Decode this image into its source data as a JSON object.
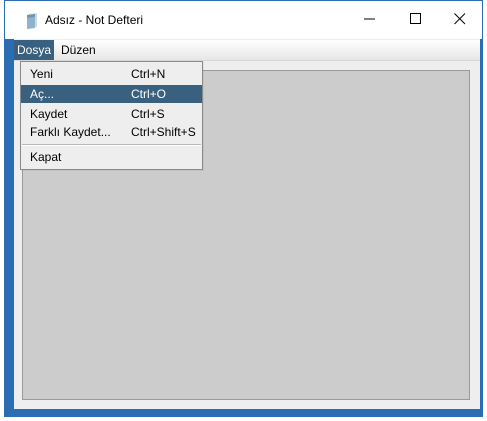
{
  "window": {
    "title": "Adsız - Not Defteri",
    "frame_color": "#2b6db3"
  },
  "menubar": {
    "menus": [
      {
        "label": "Dosya",
        "active": true
      },
      {
        "label": "Düzen",
        "active": false
      }
    ],
    "selection_color": "#39607e"
  },
  "file_menu": {
    "items": [
      {
        "label": "Yeni",
        "shortcut": "Ctrl+N"
      },
      {
        "label": "Aç...",
        "shortcut": "Ctrl+O",
        "selected": true
      },
      {
        "label": "Kaydet",
        "shortcut": "Ctrl+S"
      },
      {
        "label": "Farklı Kaydet...",
        "shortcut": "Ctrl+Shift+S"
      },
      {
        "label": "Kapat",
        "shortcut": ""
      }
    ]
  },
  "editor": {
    "background": "#cccccc"
  },
  "icons": {
    "app": "notepad-app-icon",
    "minimize": "minimize-icon",
    "maximize": "maximize-icon",
    "close": "close-icon"
  }
}
